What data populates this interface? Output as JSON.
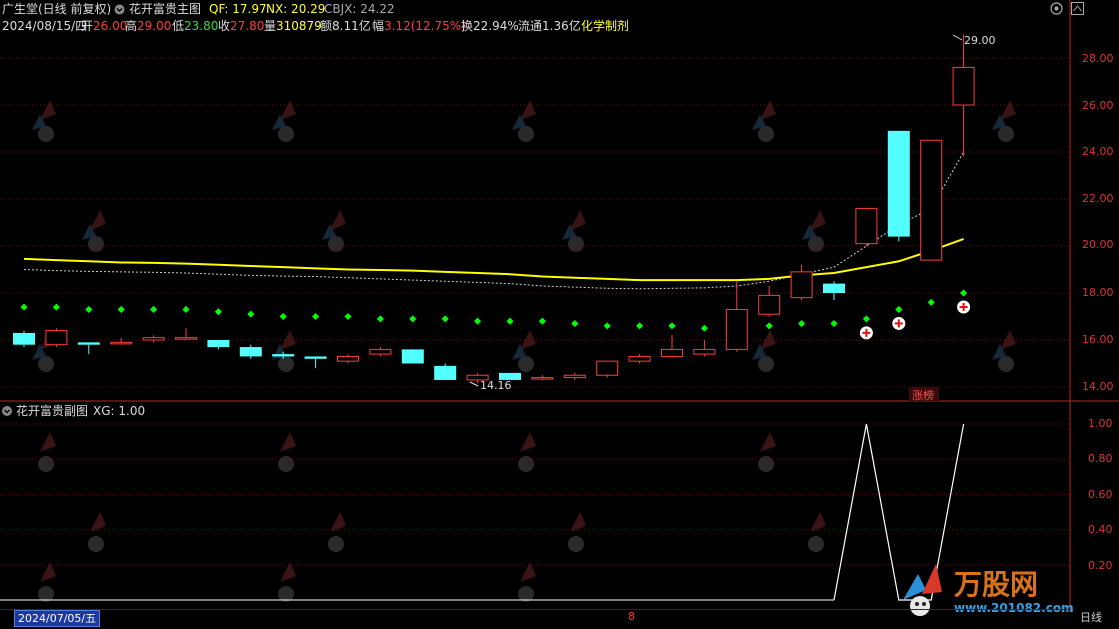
{
  "header": {
    "stock_name": "广生堂",
    "mode": "(日线 前复权)",
    "indicator_name": "花开富贵主图",
    "qf_label": "QF: 17.97",
    "nx_label": "NX: 20.29",
    "cbjx_label": "CBJX: 24.22"
  },
  "info": {
    "date": "2024/08/15/四",
    "open_label": "开",
    "open_value": "26.00",
    "high_label": "高",
    "high_value": "29.00",
    "low_label": "低",
    "low_value": "23.80",
    "close_label": "收",
    "close_value": "27.80",
    "volume_label": "量",
    "volume_value": "310879",
    "amount_label": "额",
    "amount_value": "8.11亿",
    "change_label": "幅",
    "change_value": "3.12(12.75%)",
    "turnover": "换22.94%",
    "float_cap": "流通1.36亿",
    "industry": "化学制剂"
  },
  "main_chart": {
    "y_ticks": [
      "28.00",
      "26.00",
      "24.00",
      "22.00",
      "20.00",
      "18.00",
      "16.00",
      "14.00"
    ],
    "high_annotation": "29.00",
    "low_annotation": "14.16",
    "limit_up_tag": "涨榜"
  },
  "sub_chart": {
    "title": "花开富贵副图",
    "xg_label": "XG: 1.00",
    "y_ticks": [
      "1.00",
      "0.80",
      "0.60",
      "0.40",
      "0.20"
    ]
  },
  "bottom": {
    "cursor_date": "2024/07/05/五",
    "marker": "8",
    "period": "日线"
  },
  "watermark": {
    "brand": "万股网",
    "site": "www.201082.com"
  },
  "colors": {
    "up": "#ff3c3c",
    "down": "#54ffff",
    "ma_yellow": "#ffff00",
    "dots_green": "#00ff00",
    "grid_red": "#8b0000"
  },
  "chart_data": {
    "type": "candlestick",
    "ylim": [
      13.4,
      29.6
    ],
    "candles": [
      {
        "o": 16.3,
        "c": 15.8,
        "h": 16.4,
        "l": 15.7
      },
      {
        "o": 15.8,
        "c": 16.4,
        "h": 16.5,
        "l": 15.7
      },
      {
        "o": 15.9,
        "c": 15.8,
        "h": 15.9,
        "l": 15.4
      },
      {
        "o": 15.9,
        "c": 15.9,
        "h": 16.1,
        "l": 15.8
      },
      {
        "o": 16.0,
        "c": 16.1,
        "h": 16.2,
        "l": 15.9
      },
      {
        "o": 16.1,
        "c": 16.1,
        "h": 16.5,
        "l": 16.0
      },
      {
        "o": 16.0,
        "c": 15.7,
        "h": 16.0,
        "l": 15.6
      },
      {
        "o": 15.7,
        "c": 15.3,
        "h": 15.8,
        "l": 15.2
      },
      {
        "o": 15.4,
        "c": 15.3,
        "h": 15.5,
        "l": 15.2
      },
      {
        "o": 15.3,
        "c": 15.2,
        "h": 15.3,
        "l": 14.8
      },
      {
        "o": 15.1,
        "c": 15.3,
        "h": 15.4,
        "l": 15.0
      },
      {
        "o": 15.4,
        "c": 15.6,
        "h": 15.7,
        "l": 15.3
      },
      {
        "o": 15.6,
        "c": 15.0,
        "h": 15.6,
        "l": 15.0
      },
      {
        "o": 14.9,
        "c": 14.3,
        "h": 15.0,
        "l": 14.3
      },
      {
        "o": 14.3,
        "c": 14.5,
        "h": 14.6,
        "l": 14.16
      },
      {
        "o": 14.6,
        "c": 14.3,
        "h": 14.6,
        "l": 14.3
      },
      {
        "o": 14.4,
        "c": 14.4,
        "h": 14.5,
        "l": 14.3
      },
      {
        "o": 14.4,
        "c": 14.5,
        "h": 14.6,
        "l": 14.3
      },
      {
        "o": 14.5,
        "c": 15.1,
        "h": 15.1,
        "l": 14.4
      },
      {
        "o": 15.1,
        "c": 15.3,
        "h": 15.4,
        "l": 15.0
      },
      {
        "o": 15.3,
        "c": 15.6,
        "h": 16.2,
        "l": 15.3
      },
      {
        "o": 15.4,
        "c": 15.6,
        "h": 16.0,
        "l": 15.3
      },
      {
        "o": 15.6,
        "c": 17.3,
        "h": 18.5,
        "l": 15.5
      },
      {
        "o": 17.1,
        "c": 17.9,
        "h": 18.3,
        "l": 17.0
      },
      {
        "o": 17.8,
        "c": 18.9,
        "h": 19.2,
        "l": 17.7
      },
      {
        "o": 18.4,
        "c": 18.0,
        "h": 18.5,
        "l": 17.7
      },
      {
        "o": 20.1,
        "c": 21.6,
        "h": 21.6,
        "l": 20.0
      },
      {
        "o": 24.9,
        "c": 20.4,
        "h": 24.9,
        "l": 20.2
      },
      {
        "o": 19.4,
        "c": 24.5,
        "h": 24.5,
        "l": 19.4
      },
      {
        "o": 26.0,
        "c": 27.6,
        "h": 29.0,
        "l": 23.8
      }
    ],
    "ma_yellow": [
      19.45,
      19.4,
      19.35,
      19.3,
      19.28,
      19.25,
      19.2,
      19.15,
      19.1,
      19.05,
      19.0,
      18.98,
      18.95,
      18.9,
      18.85,
      18.8,
      18.7,
      18.65,
      18.6,
      18.55,
      18.55,
      18.55,
      18.55,
      18.6,
      18.75,
      18.85,
      19.1,
      19.35,
      19.8,
      20.3
    ],
    "ma_white": [
      19.0,
      18.95,
      18.92,
      18.9,
      18.88,
      18.85,
      18.8,
      18.75,
      18.72,
      18.7,
      18.65,
      18.6,
      18.55,
      18.5,
      18.45,
      18.4,
      18.3,
      18.25,
      18.2,
      18.18,
      18.2,
      18.22,
      18.3,
      18.5,
      18.8,
      19.1,
      20.0,
      20.9,
      21.6,
      24.0
    ],
    "green_dots": [
      17.4,
      17.4,
      17.3,
      17.3,
      17.3,
      17.3,
      17.2,
      17.1,
      17.0,
      17.0,
      17.0,
      16.9,
      16.9,
      16.9,
      16.8,
      16.8,
      16.8,
      16.7,
      16.6,
      16.6,
      16.6,
      16.5,
      16.5,
      16.6,
      16.7,
      16.7,
      16.9,
      17.3,
      17.6,
      18.0
    ],
    "signal_marks": [
      26,
      27,
      29
    ],
    "xg_values": [
      0,
      0,
      0,
      0,
      0,
      0,
      0,
      0,
      0,
      0,
      0,
      0,
      0,
      0,
      0,
      0,
      0,
      0,
      0,
      0,
      0,
      0,
      0,
      0,
      0,
      0,
      1,
      0,
      0,
      1
    ]
  }
}
